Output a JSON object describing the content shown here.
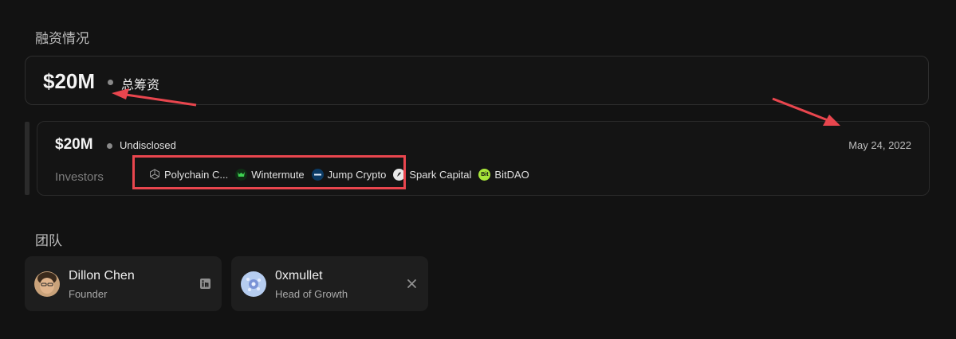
{
  "funding": {
    "section_title": "融资情况",
    "total_amount": "$20M",
    "total_label": "总筹资",
    "round": {
      "amount": "$20M",
      "type": "Undisclosed",
      "date": "May 24, 2022",
      "investors_label": "Investors",
      "investors": [
        {
          "name": "Polychain C...",
          "icon": "polychain-icon"
        },
        {
          "name": "Wintermute",
          "icon": "wintermute-icon"
        },
        {
          "name": "Jump Crypto",
          "icon": "jump-crypto-icon"
        },
        {
          "name": "Spark Capital",
          "icon": "spark-capital-icon"
        },
        {
          "name": "BitDAO",
          "icon": "bitdao-icon",
          "icon_text": "Bit"
        }
      ]
    }
  },
  "team": {
    "section_title": "团队",
    "members": [
      {
        "name": "Dillon Chen",
        "role": "Founder",
        "social": "linkedin-icon"
      },
      {
        "name": "0xmullet",
        "role": "Head of Growth",
        "social": "x-icon"
      }
    ]
  },
  "colors": {
    "background": "#121212",
    "annotation_red": "#e9464e",
    "card_border": "#2e2e2e"
  }
}
